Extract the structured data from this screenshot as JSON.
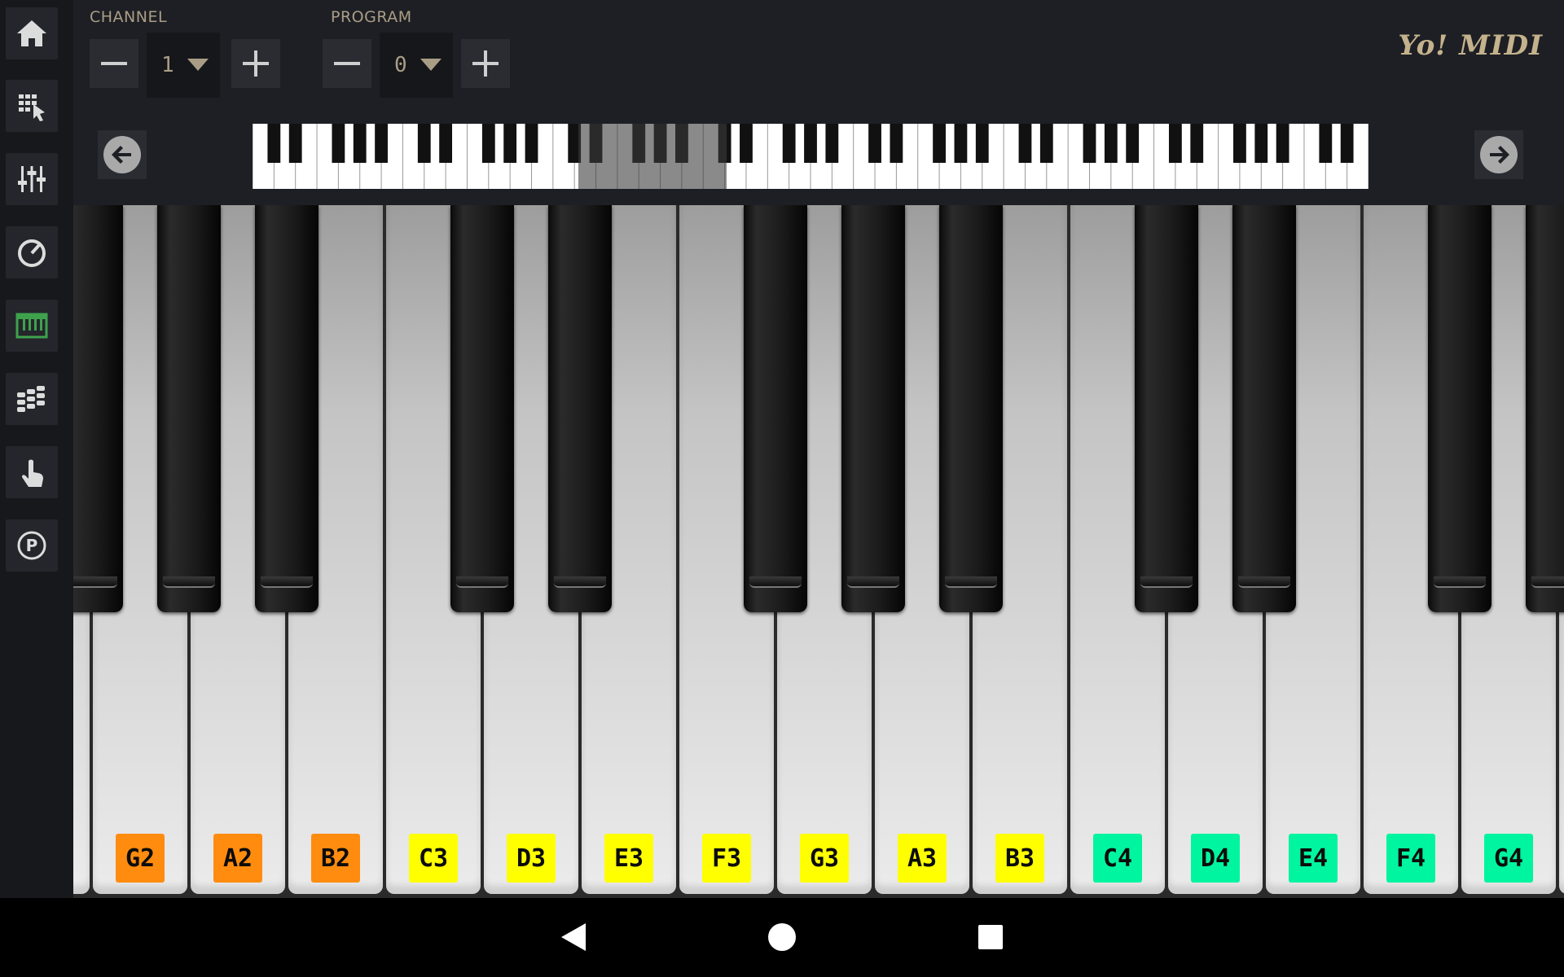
{
  "app": {
    "brand": "Yo! MIDI"
  },
  "sidebar": {
    "items": [
      {
        "icon": "home-icon"
      },
      {
        "icon": "midi-devices-icon"
      },
      {
        "icon": "mixer-icon"
      },
      {
        "icon": "tempo-icon"
      },
      {
        "icon": "keyboard-icon",
        "active": true
      },
      {
        "icon": "pads-icon"
      },
      {
        "icon": "touch-icon"
      },
      {
        "icon": "program-icon"
      }
    ]
  },
  "channel": {
    "label": "CHANNEL",
    "value": "1"
  },
  "program": {
    "label": "PROGRAM",
    "value": "0"
  },
  "keyboard": {
    "white_keys": [
      {
        "note": "G2",
        "color": "#ff8c0f"
      },
      {
        "note": "A2",
        "color": "#ff8c0f"
      },
      {
        "note": "B2",
        "color": "#ff8c0f"
      },
      {
        "note": "C3",
        "color": "#ffff00"
      },
      {
        "note": "D3",
        "color": "#ffff00"
      },
      {
        "note": "E3",
        "color": "#ffff00"
      },
      {
        "note": "F3",
        "color": "#ffff00"
      },
      {
        "note": "G3",
        "color": "#ffff00"
      },
      {
        "note": "A3",
        "color": "#ffff00"
      },
      {
        "note": "B3",
        "color": "#ffff00"
      },
      {
        "note": "C4",
        "color": "#00f5a0"
      },
      {
        "note": "D4",
        "color": "#00f5a0"
      },
      {
        "note": "E4",
        "color": "#00f5a0"
      },
      {
        "note": "F4",
        "color": "#00f5a0"
      },
      {
        "note": "G4",
        "color": "#00f5a0"
      }
    ]
  },
  "colors": {
    "accent": "#a99d86",
    "brand": "#c4b28c"
  }
}
